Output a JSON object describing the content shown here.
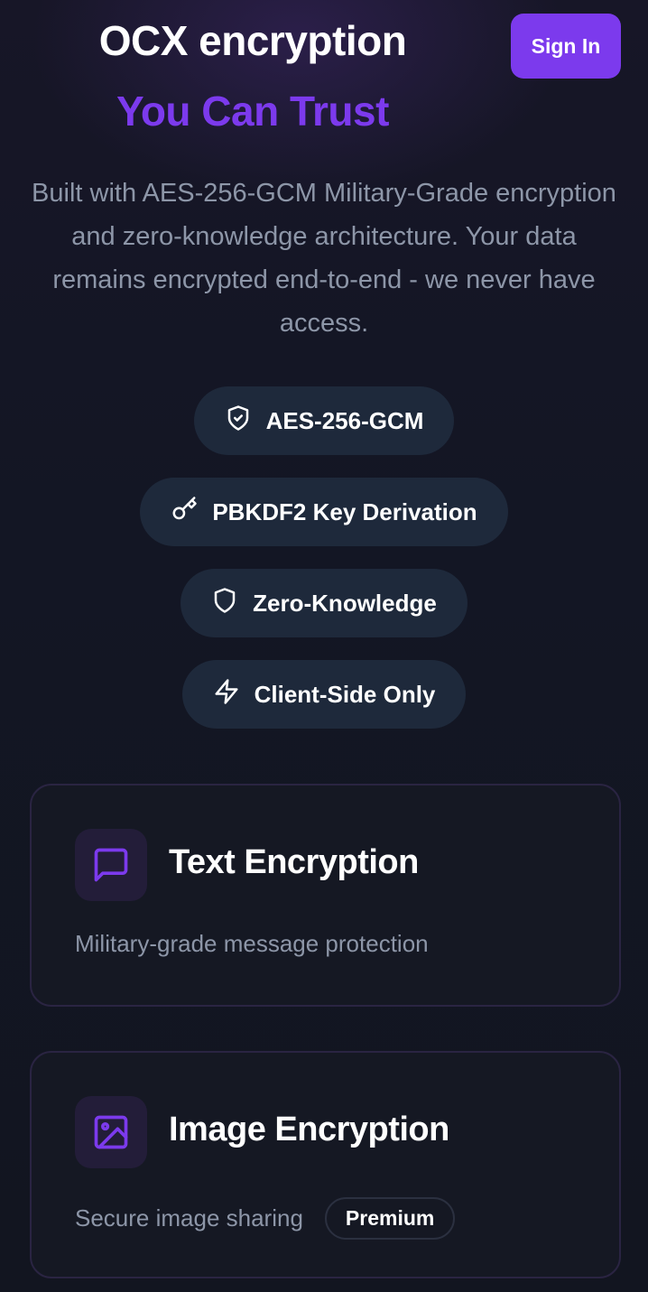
{
  "header": {
    "title_line1": "OCX encryption",
    "title_line2": "You Can Trust",
    "signin_label": "Sign In"
  },
  "description": "Built with AES-256-GCM Military-Grade encryption and zero-knowledge architecture. Your data remains encrypted end-to-end - we never have access.",
  "badges": [
    {
      "label": "AES-256-GCM",
      "icon": "shield-check-icon"
    },
    {
      "label": "PBKDF2 Key Derivation",
      "icon": "key-icon"
    },
    {
      "label": "Zero-Knowledge",
      "icon": "shield-icon"
    },
    {
      "label": "Client-Side Only",
      "icon": "lightning-icon"
    }
  ],
  "cards": [
    {
      "title": "Text Encryption",
      "subtitle": "Military-grade message protection",
      "icon": "message-square-icon"
    },
    {
      "title": "Image Encryption",
      "subtitle": "Secure image sharing",
      "badge": "Premium",
      "icon": "image-icon"
    }
  ],
  "colors": {
    "accent": "#7c3aed",
    "background": "#121520",
    "badge_bg": "#1e293b",
    "muted_text": "#8d96a8"
  }
}
